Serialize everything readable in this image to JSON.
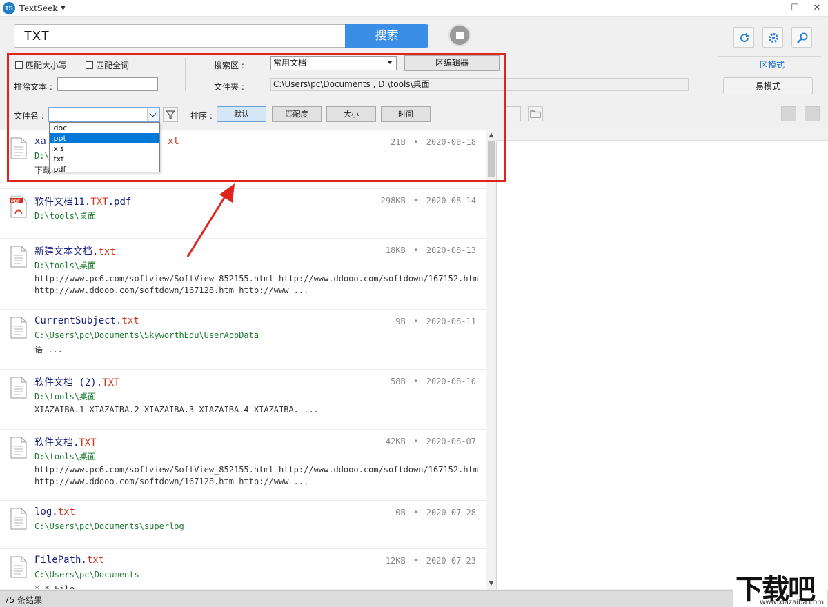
{
  "window": {
    "logo": "TS",
    "title": "TextSeek",
    "minimize": "—",
    "maximize": "☐",
    "close": "✕"
  },
  "search": {
    "value": "TXT",
    "button_label": "搜索"
  },
  "side": {
    "mode_link": "区模式",
    "mode_button": "易模式"
  },
  "options": {
    "match_case": "匹配大小写",
    "match_word": "匹配全词",
    "exclude_label": "排除文本 :",
    "exclude_value": "",
    "area_label": "搜索区 :",
    "area_value": "常用文档",
    "editor_button": "区编辑器",
    "folder_label": "文件夹 :",
    "folder_value": "C:\\Users\\pc\\Documents , D:\\tools\\桌面"
  },
  "filter": {
    "filename_label": "文件名 :",
    "filename_value": "",
    "sort_label": "排序 :",
    "sort_buttons": [
      "默认",
      "匹配度",
      "大小",
      "时间"
    ],
    "dropdown_options": [
      ".doc",
      ".ppt",
      ".xls",
      ".txt",
      ".pdf"
    ],
    "dropdown_selected": ".ppt"
  },
  "results": [
    {
      "name": "xa",
      "ext": "xt",
      "size": "21B",
      "date": "2020-08-18",
      "path": "D:\\",
      "snippet": "下载"
    },
    {
      "name": "软件文档11.",
      "ext": "TXT",
      "name_tail": ".pdf",
      "size": "298KB",
      "date": "2020-08-14",
      "path": "D:\\tools\\桌面",
      "snippet": ""
    },
    {
      "name": "新建文本文档.",
      "ext": "txt",
      "size": "18KB",
      "date": "2020-08-13",
      "path": "D:\\tools\\桌面",
      "snippet": "http://www.pc6.com/softview/SoftView_852155.html http://www.ddooo.com/softdown/167152.htm\nhttp://www.ddooo.com/softdown/167128.htm http://www ..."
    },
    {
      "name": "CurrentSubject.",
      "ext": "txt",
      "size": "9B",
      "date": "2020-08-11",
      "path": "C:\\Users\\pc\\Documents\\SkyworthEdu\\UserAppData",
      "snippet": "语 ..."
    },
    {
      "name": "软件文档 (2).",
      "ext": "TXT",
      "size": "58B",
      "date": "2020-08-10",
      "path": "D:\\tools\\桌面",
      "snippet": "XIAZAIBA.1 XIAZAIBA.2 XIAZAIBA.3 XIAZAIBA.4 XIAZAIBA. ..."
    },
    {
      "name": "软件文档.",
      "ext": "TXT",
      "size": "42KB",
      "date": "2020-08-07",
      "path": "D:\\tools\\桌面",
      "snippet": "http://www.pc6.com/softview/SoftView_852155.html http://www.ddooo.com/softdown/167152.htm\nhttp://www.ddooo.com/softdown/167128.htm http://www ..."
    },
    {
      "name": "log.",
      "ext": "txt",
      "size": "0B",
      "date": "2020-07-28",
      "path": "C:\\Users\\pc\\Documents\\superlog",
      "snippet": ""
    },
    {
      "name": "FilePath.",
      "ext": "txt",
      "size": "12KB",
      "date": "2020-07-23",
      "path": "C:\\Users\\pc\\Documents",
      "snippet": "* * File"
    }
  ],
  "meta_dot": "•",
  "status": "75 条结果",
  "watermark": {
    "main": "下载吧",
    "sub": "www.xiazaiba.com"
  },
  "colors": {
    "accent": "#3a8ee6",
    "annotation": "#e0231c",
    "extension": "#d2381f",
    "path": "#1a7a2e"
  }
}
